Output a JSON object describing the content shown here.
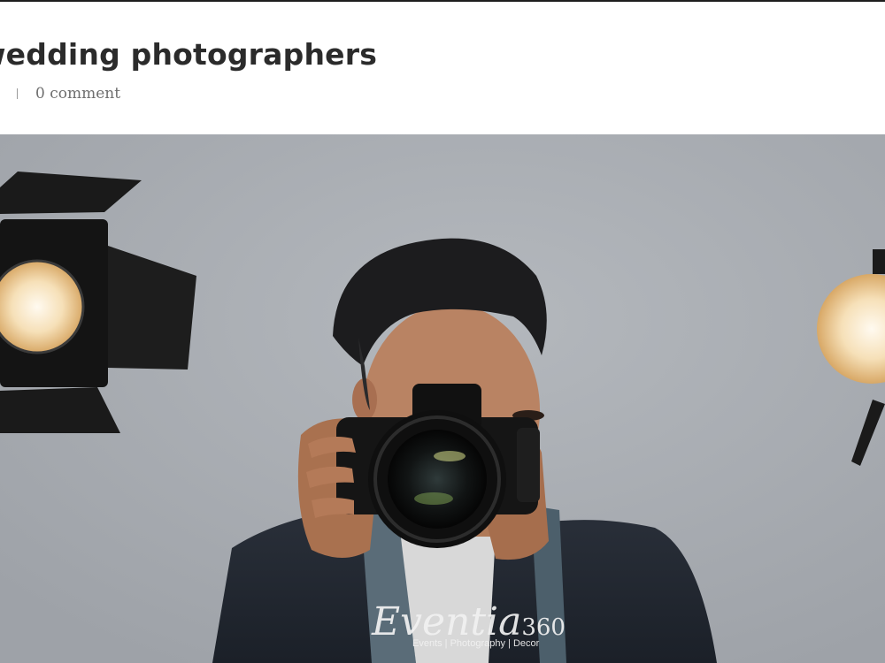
{
  "article": {
    "title": "wedding photographers",
    "meta": {
      "comments": "0 comment"
    }
  },
  "hero": {
    "watermark": {
      "brand": "Eventia",
      "brand_number": "360",
      "tagline": "Events | Photography | Decor"
    }
  },
  "colors": {
    "title": "#2b2b2b",
    "meta": "#6e6e6e",
    "backdrop": "#a9adb3"
  }
}
